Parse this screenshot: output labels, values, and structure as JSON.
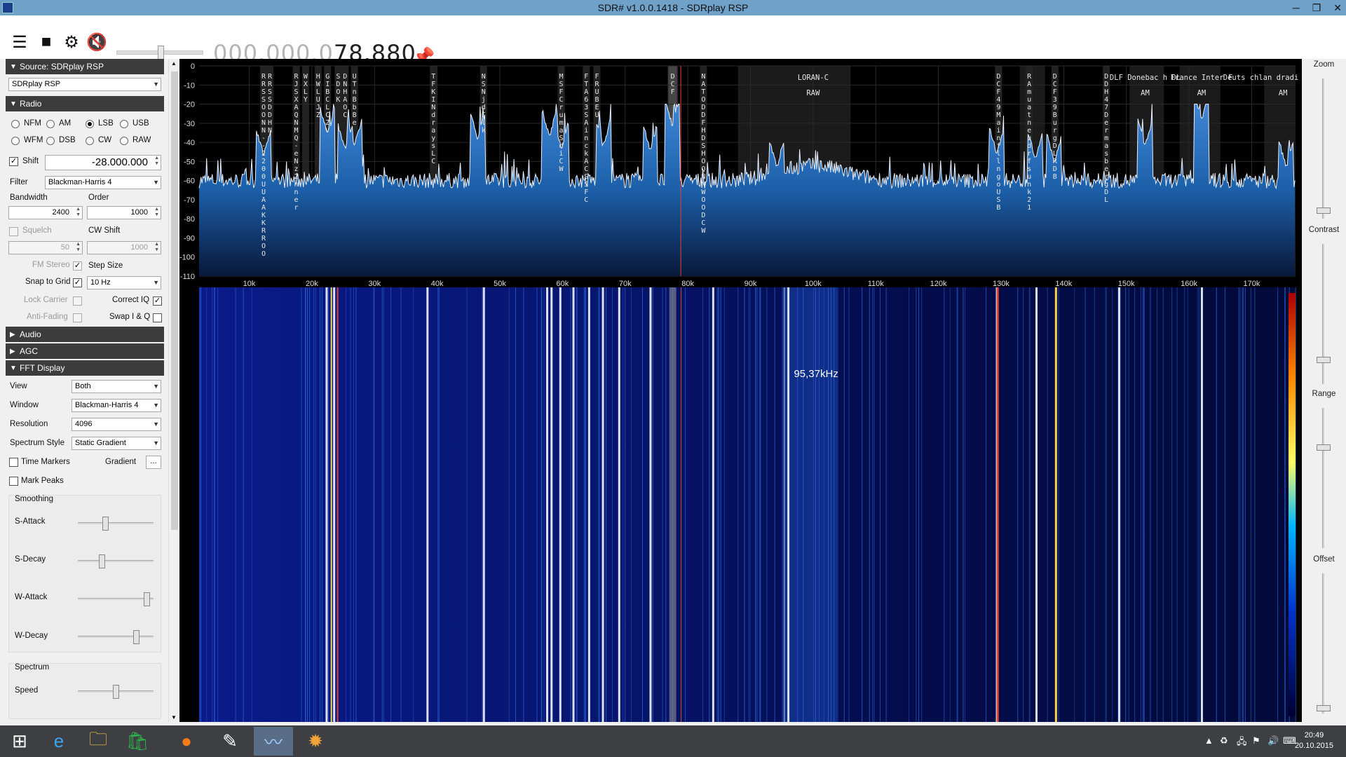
{
  "window": {
    "title": "SDR# v1.0.0.1418 - SDRplay RSP"
  },
  "toolbar": {
    "freq_dim": "000.000.0",
    "freq_bright": "78.880"
  },
  "source": {
    "header": "Source: SDRplay RSP",
    "device": "SDRplay RSP"
  },
  "radio": {
    "header": "Radio",
    "modes": [
      "NFM",
      "AM",
      "LSB",
      "USB",
      "WFM",
      "DSB",
      "CW",
      "RAW"
    ],
    "selected_mode": "LSB",
    "shift_label": "Shift",
    "shift_value": "-28.000.000",
    "filter_label": "Filter",
    "filter_value": "Blackman-Harris 4",
    "bandwidth_label": "Bandwidth",
    "bandwidth_value": "2400",
    "order_label": "Order",
    "order_value": "1000",
    "squelch_label": "Squelch",
    "squelch_value": "50",
    "cwshift_label": "CW Shift",
    "cwshift_value": "1000",
    "fmstereo_label": "FM Stereo",
    "stepsize_label": "Step Size",
    "snap_label": "Snap to Grid",
    "step_value": "10 Hz",
    "lockcarrier_label": "Lock Carrier",
    "correctiq_label": "Correct IQ",
    "antifading_label": "Anti-Fading",
    "swapiq_label": "Swap I & Q"
  },
  "audio": {
    "header": "Audio"
  },
  "agc": {
    "header": "AGC"
  },
  "fft": {
    "header": "FFT Display",
    "view_label": "View",
    "view_value": "Both",
    "window_label": "Window",
    "window_value": "Blackman-Harris 4",
    "resolution_label": "Resolution",
    "resolution_value": "4096",
    "style_label": "Spectrum Style",
    "style_value": "Static Gradient",
    "timemarkers_label": "Time Markers",
    "gradient_label": "Gradient",
    "gradient_btn": "...",
    "markpeaks_label": "Mark Peaks",
    "smoothing_label": "Smoothing",
    "sattack_label": "S-Attack",
    "sattack_level": 0.35,
    "sdecay_label": "S-Decay",
    "sdecay_level": 0.3,
    "wattack_label": "W-Attack",
    "wattack_level": 0.95,
    "wdecay_label": "W-Decay",
    "wdecay_level": 0.8,
    "spectrum_label": "Spectrum",
    "speed_label": "Speed",
    "speed_level": 0.5
  },
  "right": {
    "zoom": "Zoom",
    "contrast": "Contrast",
    "range": "Range",
    "offset": "Offset"
  },
  "waterfall": {
    "cursor_label": "95,37kHz"
  },
  "colors": {
    "spectrum_fill": "#1c5fa8",
    "waterfall_bg": "#020a3a",
    "accent_red": "#e0442c",
    "accent_yellow": "#ffd24a"
  },
  "taskbar": {
    "time": "20:49",
    "date": "20.10.2015"
  },
  "chart_data": {
    "type": "area",
    "x_unit": "kHz",
    "y_unit": "dB",
    "ylim": [
      -110,
      0
    ],
    "xlim": [
      2,
      177
    ],
    "y_ticks": [
      "0",
      "-10",
      "-20",
      "-30",
      "-40",
      "-50",
      "-60",
      "-70",
      "-80",
      "-90",
      "-100",
      "-110"
    ],
    "x_ticks": [
      "10k",
      "20k",
      "30k",
      "40k",
      "50k",
      "60k",
      "70k",
      "80k",
      "90k",
      "100k",
      "110k",
      "120k",
      "130k",
      "140k",
      "150k",
      "160k",
      "170k"
    ],
    "band_labels": [
      {
        "text": "LORAN-C",
        "x": 100
      },
      {
        "text": "RAW",
        "x": 100
      },
      {
        "text": "DLF Donebac h DL",
        "x": 153
      },
      {
        "text": "AM",
        "x": 153
      },
      {
        "text": "France Inter F",
        "x": 162
      },
      {
        "text": "AM",
        "x": 162
      },
      {
        "text": "Deuts chlan dradi o Kultu r",
        "x": 175
      },
      {
        "text": "AM",
        "x": 175
      }
    ],
    "station_columns": [
      {
        "text": "RRSSOONN--2200UUAAKKRROOAAMMSSSSOOMMDDOOAALLRRSSKKCCWC",
        "x": 12.3
      },
      {
        "text": "RRSSDDHN",
        "x": 13.3
      },
      {
        "text": "RJSXAQNMQ-eNz2nner",
        "x": 17.5
      },
      {
        "text": "WXLY",
        "x": 19.0
      },
      {
        "text": "HWLUJZ",
        "x": 21.0
      },
      {
        "text": "GIBCLCZV",
        "x": 22.5
      },
      {
        "text": "SDOK",
        "x": 24.2
      },
      {
        "text": "DNHAOC",
        "x": 25.3
      },
      {
        "text": "UTnBbBe",
        "x": 26.8
      },
      {
        "text": "TFKINdraysLC",
        "x": 39.4
      },
      {
        "text": "NSNjdClk",
        "x": 47.4
      },
      {
        "text": "MSFCrumaSdiCW",
        "x": 59.8
      },
      {
        "text": "FTA63SAinckACSSFC",
        "x": 63.8
      },
      {
        "text": "FRUBEU",
        "x": 65.5
      },
      {
        "text": "DCF",
        "x": 77.6
      },
      {
        "text": "NATODDFHDSHOQNNWOODCW",
        "x": 82.5
      },
      {
        "text": "DCF49MainfllngoUSB",
        "x": 129.6
      },
      {
        "text": "RAmuatneudrfsunk21",
        "x": 134.5
      },
      {
        "text": "DCF39BurgDLRDB",
        "x": 138.6
      },
      {
        "text": "DDH47DermasbergDL",
        "x": 146.8
      }
    ],
    "peaks": [
      {
        "x": 12.3,
        "y": -47
      },
      {
        "x": 22.5,
        "y": -36
      },
      {
        "x": 25.3,
        "y": -44
      },
      {
        "x": 26.8,
        "y": -42
      },
      {
        "x": 46.5,
        "y": -38
      },
      {
        "x": 57.8,
        "y": -38
      },
      {
        "x": 58.0,
        "y": -38
      },
      {
        "x": 59.8,
        "y": -43
      },
      {
        "x": 66.5,
        "y": -42
      },
      {
        "x": 74.0,
        "y": -44
      },
      {
        "x": 77.5,
        "y": -31
      },
      {
        "x": 94.2,
        "y": -53
      },
      {
        "x": 129.3,
        "y": -46
      },
      {
        "x": 135.5,
        "y": -49
      },
      {
        "x": 138.5,
        "y": -50
      },
      {
        "x": 153.0,
        "y": -42
      },
      {
        "x": 162.0,
        "y": -28
      },
      {
        "x": 175.5,
        "y": -53
      }
    ],
    "noise_floor_db": -60
  }
}
